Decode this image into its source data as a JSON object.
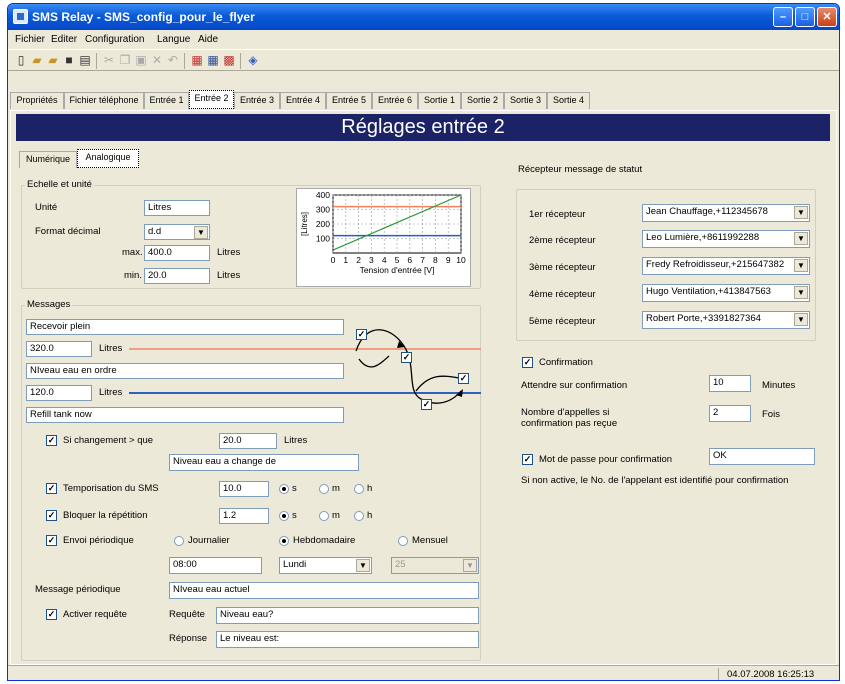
{
  "window": {
    "title": "SMS Relay - SMS_config_pour_le_flyer"
  },
  "menu": [
    "Fichier",
    "Editer",
    "Configuration",
    "Langue",
    "Aide"
  ],
  "tabs": [
    "Propriétés",
    "Fichier téléphone",
    "Entrée 1",
    "Entrée 2",
    "Entrée 3",
    "Entrée 4",
    "Entrée 5",
    "Entrée 6",
    "Sortie 1",
    "Sortie 2",
    "Sortie 3",
    "Sortie 4"
  ],
  "banner": "Réglages entrée 2",
  "subtabs": [
    "Numérique",
    "Analogique"
  ],
  "scale": {
    "group": "Echelle et unité",
    "unit_label": "Unité",
    "unit_value": "Litres",
    "format_label": "Format décimal",
    "format_value": "d.d",
    "max_label": "max.",
    "max_value": "400.0",
    "min_label": "min.",
    "min_value": "20.0",
    "unit_suffix": "Litres"
  },
  "chart_data": {
    "type": "line",
    "xlabel": "Tension d'entrée [V]",
    "ylabel": "[Litres]",
    "x_ticks": [
      "0",
      "1",
      "2",
      "3",
      "4",
      "5",
      "6",
      "7",
      "8",
      "9",
      "10"
    ],
    "y_ticks": [
      "400",
      "300",
      "200",
      "100"
    ],
    "xlim": [
      0,
      10
    ],
    "ylim": [
      0,
      400
    ],
    "series": [
      {
        "values": [
          [
            0,
            20
          ],
          [
            10,
            400
          ]
        ],
        "color": "#2a9a3a"
      }
    ],
    "thresholds": [
      {
        "value": 320,
        "color": "#f08060"
      },
      {
        "value": 120,
        "color": "#2060c0"
      }
    ],
    "grid": true
  },
  "messages": {
    "group": "Messages",
    "msg_high": "Recevoir plein",
    "high_value": "320.0",
    "high_unit": "Litres",
    "msg_mid": "NIveau eau en ordre",
    "low_value": "120.0",
    "low_unit": "Litres",
    "msg_low": "Refill tank now"
  },
  "options": {
    "change_label": "Si changement > que",
    "change_value": "20.0",
    "change_unit": "Litres",
    "change_msg": "Niveau eau  a change de",
    "delay_label": "Temporisation du SMS",
    "delay_value": "10.0",
    "block_label": "Bloquer la répétition",
    "block_value": "1.2",
    "unit_s": "s",
    "unit_m": "m",
    "unit_h": "h",
    "periodic_label": "Envoi périodique",
    "daily": "Journalier",
    "weekly": "Hebdomadaire",
    "monthly": "Mensuel",
    "time_value": "08:00",
    "day_value": "Lundi",
    "month_day": "25",
    "periodic_msg_label": "Message périodique",
    "periodic_msg": "NIveau eau actuel",
    "request_label": "Activer requête",
    "request_q_label": "Requête",
    "request_q": "Niveau eau?",
    "request_a_label": "Réponse",
    "request_a": "Le niveau est:"
  },
  "receivers": {
    "title": "Récepteur message de statut",
    "items": [
      {
        "label": "1er récepteur",
        "value": "Jean Chauffage,+112345678"
      },
      {
        "label": "2ème récepteur",
        "value": "Leo Lumière,+8611992288"
      },
      {
        "label": "3ème récepteur",
        "value": "Fredy Refroidisseur,+215647382"
      },
      {
        "label": "4ème récepteur",
        "value": "Hugo Ventilation,+413847563"
      },
      {
        "label": "5ème récepteur",
        "value": "Robert Porte,+3391827364"
      }
    ]
  },
  "confirm": {
    "label": "Confirmation",
    "wait_label": "Attendre sur confirmation",
    "wait_value": "10",
    "wait_unit": "Minutes",
    "count_label": "Nombre d'appelles si confirmation pas reçue",
    "count_value": "2",
    "count_unit": "Fois",
    "pwd_label": "Mot de passe pour confirmation",
    "pwd_value": "OK",
    "note": "Si non active, le No. de l'appelant est identifié pour confirmation"
  },
  "status": {
    "datetime": "04.07.2008 16:25:13"
  }
}
